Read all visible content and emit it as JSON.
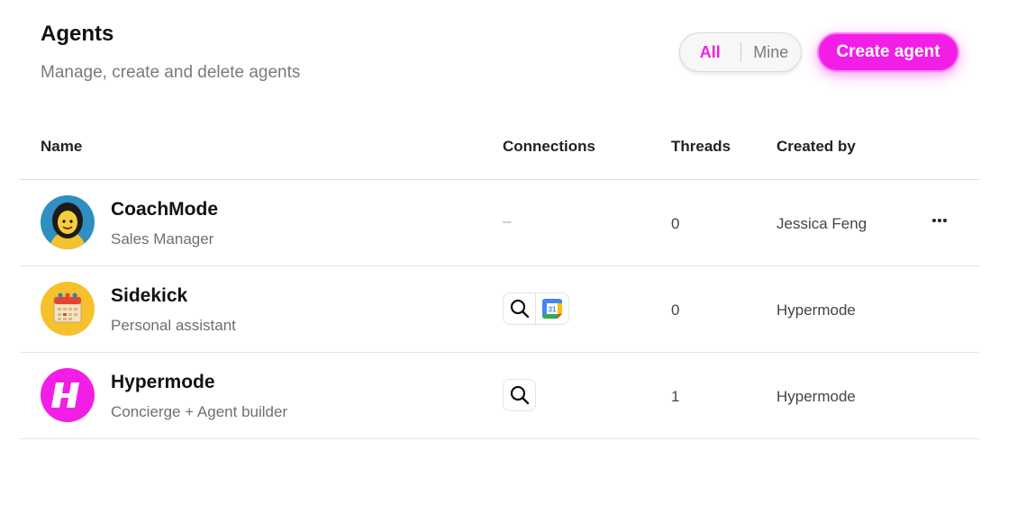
{
  "header": {
    "title": "Agents",
    "subtitle": "Manage, create and delete agents"
  },
  "filter": {
    "all_label": "All",
    "mine_label": "Mine",
    "selected": "All"
  },
  "actions": {
    "create_label": "Create agent"
  },
  "colors": {
    "accent": "#f21ee6",
    "text_primary": "#111111",
    "text_muted": "#7a7a7a"
  },
  "table": {
    "columns": {
      "name": "Name",
      "connections": "Connections",
      "threads": "Threads",
      "created_by": "Created by"
    },
    "rows": [
      {
        "name": "CoachMode",
        "role": "Sales Manager",
        "avatar": "woman-avatar-icon",
        "connections": [],
        "connections_empty": "–",
        "threads": "0",
        "created_by": "Jessica Feng",
        "has_menu": true
      },
      {
        "name": "Sidekick",
        "role": "Personal assistant",
        "avatar": "calendar-avatar-icon",
        "connections": [
          "search-icon",
          "google-calendar-icon"
        ],
        "calendar_day": "31",
        "threads": "0",
        "created_by": "Hypermode",
        "has_menu": false
      },
      {
        "name": "Hypermode",
        "role": "Concierge + Agent builder",
        "avatar": "hypermode-logo-icon",
        "connections": [
          "search-icon"
        ],
        "threads": "1",
        "created_by": "Hypermode",
        "has_menu": false
      }
    ]
  }
}
